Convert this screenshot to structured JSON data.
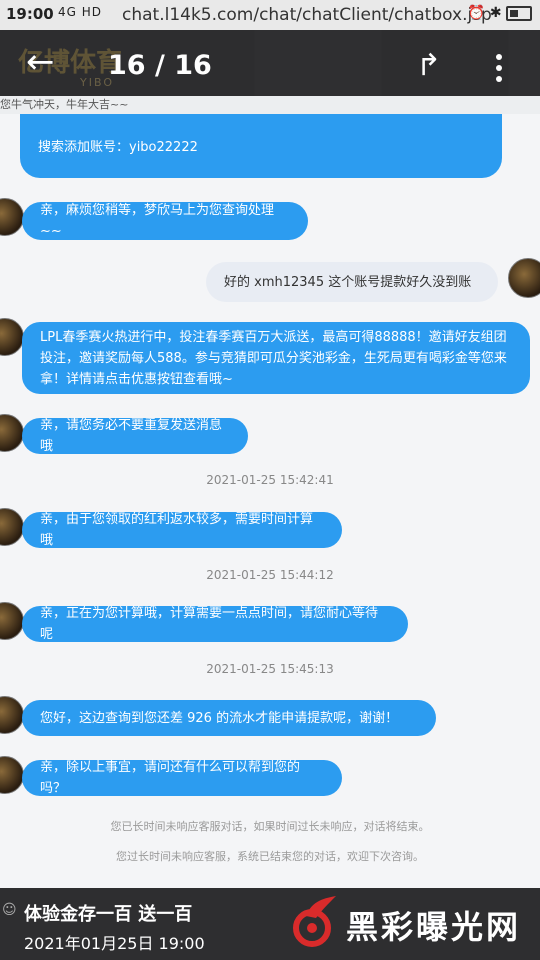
{
  "status_bar": {
    "time": "19:00",
    "signal": "4G HD",
    "url": "chat.l14k5.com/chat/chatClient/chatbox.jsp",
    "icons": [
      "alarm-icon",
      "bluetooth-icon",
      "battery-icon"
    ]
  },
  "viewer": {
    "counter": "16 / 16",
    "brand": "亿博体育",
    "brand_sub": "YIBO"
  },
  "ticker": "您牛气冲天，牛年大吉~~",
  "messages": [
    {
      "from": "agent",
      "text": "搜索添加账号：yibo22222"
    },
    {
      "from": "agent",
      "text": "亲，麻烦您稍等，梦欣马上为您查询处理~~"
    },
    {
      "from": "user",
      "text": "好的     xmh12345   这个账号提款好久没到账"
    },
    {
      "from": "agent",
      "text": "LPL春季赛火热进行中，投注春季赛百万大派送，最高可得88888！邀请好友组团投注，邀请奖励每人588。参与竞猜即可瓜分奖池彩金，生死局更有喝彩金等您来拿！详情请点击优惠按钮查看哦~"
    },
    {
      "from": "agent",
      "text": "亲，请您务必不要重复发送消息哦"
    },
    {
      "from": "time",
      "text": "2021-01-25 15:42:41"
    },
    {
      "from": "agent",
      "text": "亲，由于您领取的红利返水较多，需要时间计算哦"
    },
    {
      "from": "time",
      "text": "2021-01-25 15:44:12"
    },
    {
      "from": "agent",
      "text": "亲，正在为您计算哦，计算需要一点点时间，请您耐心等待呢"
    },
    {
      "from": "time",
      "text": "2021-01-25 15:45:13"
    },
    {
      "from": "agent",
      "text": "您好，这边查询到您还差 926       的流水才能申请提款呢，谢谢！"
    },
    {
      "from": "agent",
      "text": "亲，除以上事宜，请问还有什么可以帮到您的吗？"
    }
  ],
  "notices": [
    "您已长时间未响应客服对话，如果时间过长未响应，对话将结束。",
    "您过长时间未响应客服，系统已结束您的对话，欢迎下次咨询。"
  ],
  "banner": {
    "caption": "体验金存一百 送一百",
    "date": "2021年01月25日 19:00",
    "watermark": "黑彩曝光网"
  },
  "colors": {
    "agent_bubble": "#2c9cf0",
    "user_bubble": "#e8ecf3",
    "watermark_red": "#d92b2b"
  }
}
